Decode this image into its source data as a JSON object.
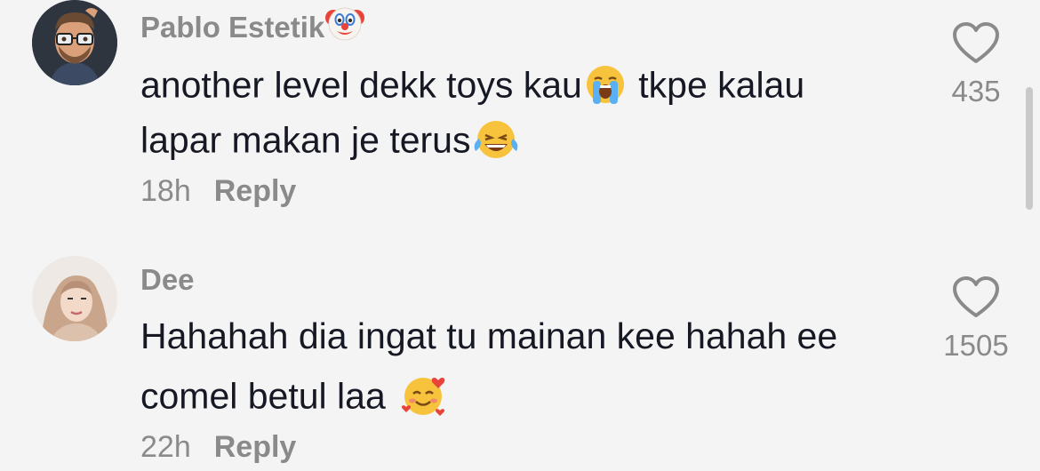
{
  "comments": [
    {
      "username": "Pablo Estetik",
      "username_emoji": "clown-face-emoji",
      "lines": [
        {
          "before": "another level dekk toys kau",
          "emoji": "loudly-crying-face-emoji",
          "after": " tkpe kalau"
        },
        {
          "before": "lapar makan je terus",
          "emoji": "face-with-tears-of-joy-emoji",
          "after": ""
        }
      ],
      "time": "18h",
      "reply_label": "Reply",
      "likes": "435",
      "avatar": "memoji-man-glasses-avatar"
    },
    {
      "username": "Dee",
      "lines": [
        {
          "before": "Hahahah dia ingat tu mainan kee hahah ee",
          "emoji": "",
          "after": ""
        },
        {
          "before": "comel betul laa ",
          "emoji": "smiling-face-with-hearts-emoji",
          "after": ""
        }
      ],
      "time": "22h",
      "reply_label": "Reply",
      "likes": "1505",
      "avatar": "woman-hijab-avatar"
    }
  ],
  "icons": {
    "like": "heart-outline-icon"
  },
  "colors": {
    "background": "#f4f4f4",
    "text": "#161823",
    "muted": "#8a8a8a"
  }
}
